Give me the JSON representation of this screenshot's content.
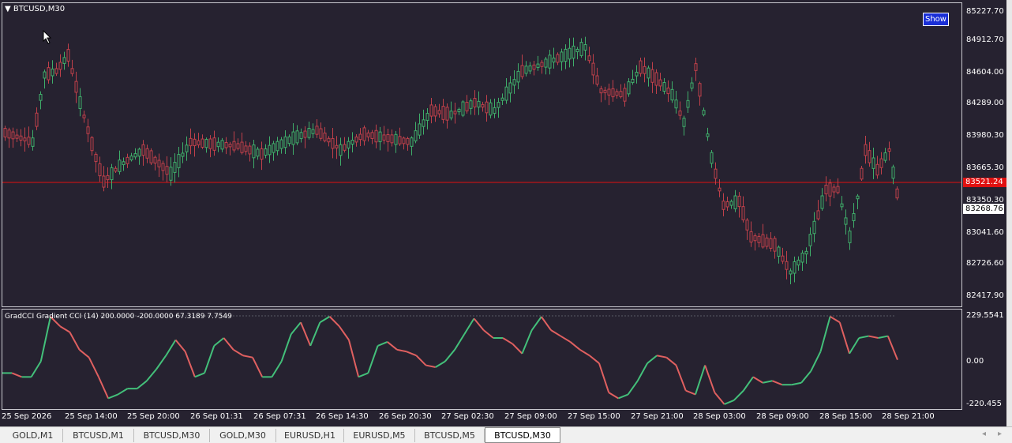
{
  "chart": {
    "title": "BTCUSD,M30",
    "show_label": "Show",
    "current_price": "83521.24",
    "bid_price": "83268.76",
    "indicator_title": "GradCCI Gradient CCI (14) 200.0000 -200.0000 67.3189 7.7549",
    "price_levels": [
      "85227.70",
      "84912.70",
      "84604.00",
      "84289.00",
      "83980.30",
      "83665.30",
      "83350.30",
      "83041.60",
      "82726.60",
      "82417.90"
    ],
    "cci_levels": [
      "229.5541",
      "0.00",
      "-220.455"
    ],
    "time_labels": [
      "25 Sep 2026",
      "25 Sep 14:00",
      "25 Sep 20:00",
      "26 Sep 01:31",
      "26 Sep 07:31",
      "26 Sep 14:30",
      "26 Sep 20:30",
      "27 Sep 02:30",
      "27 Sep 09:00",
      "27 Sep 15:00",
      "27 Sep 21:00",
      "28 Sep 03:00",
      "28 Sep 09:00",
      "28 Sep 15:00",
      "28 Sep 21:00"
    ],
    "colors": {
      "bull": "#3fae6a",
      "bear": "#c0404a",
      "cci_up": "#43c07a",
      "cci_down": "#e06060",
      "price_line": "#e01010",
      "background": "#262230"
    }
  },
  "tabs": [
    {
      "label": "GOLD,M1"
    },
    {
      "label": "BTCUSD,M1"
    },
    {
      "label": "BTCUSD,M30"
    },
    {
      "label": "GOLD,M30"
    },
    {
      "label": "EURUSD,H1"
    },
    {
      "label": "EURUSD,M5"
    },
    {
      "label": "BTCUSD,M5"
    },
    {
      "label": "BTCUSD,M30",
      "active": true
    }
  ],
  "chart_data": {
    "type": "line",
    "series": [
      {
        "name": "Gradient CCI (14)",
        "y": [
          -60,
          -60,
          -80,
          -80,
          0,
          229,
          180,
          150,
          60,
          20,
          -80,
          -190,
          -170,
          -140,
          -140,
          -100,
          -40,
          30,
          110,
          50,
          -80,
          -60,
          80,
          120,
          60,
          30,
          20,
          -80,
          -80,
          0,
          140,
          200,
          80,
          200,
          230,
          180,
          110,
          -80,
          -60,
          80,
          100,
          60,
          50,
          30,
          -20,
          -30,
          0,
          60,
          140,
          220,
          160,
          120,
          120,
          90,
          40,
          160,
          229,
          160,
          130,
          100,
          60,
          30,
          -10,
          -160,
          -190,
          -170,
          -100,
          -10,
          30,
          20,
          -20,
          -150,
          -170,
          -20,
          -160,
          -220,
          -200,
          -150,
          -80,
          -110,
          -100,
          -120,
          -120,
          -110,
          -50,
          50,
          230,
          200,
          40,
          120,
          130,
          120,
          130,
          8
        ]
      }
    ],
    "ylim": [
      -220.455,
      229.5541
    ]
  }
}
